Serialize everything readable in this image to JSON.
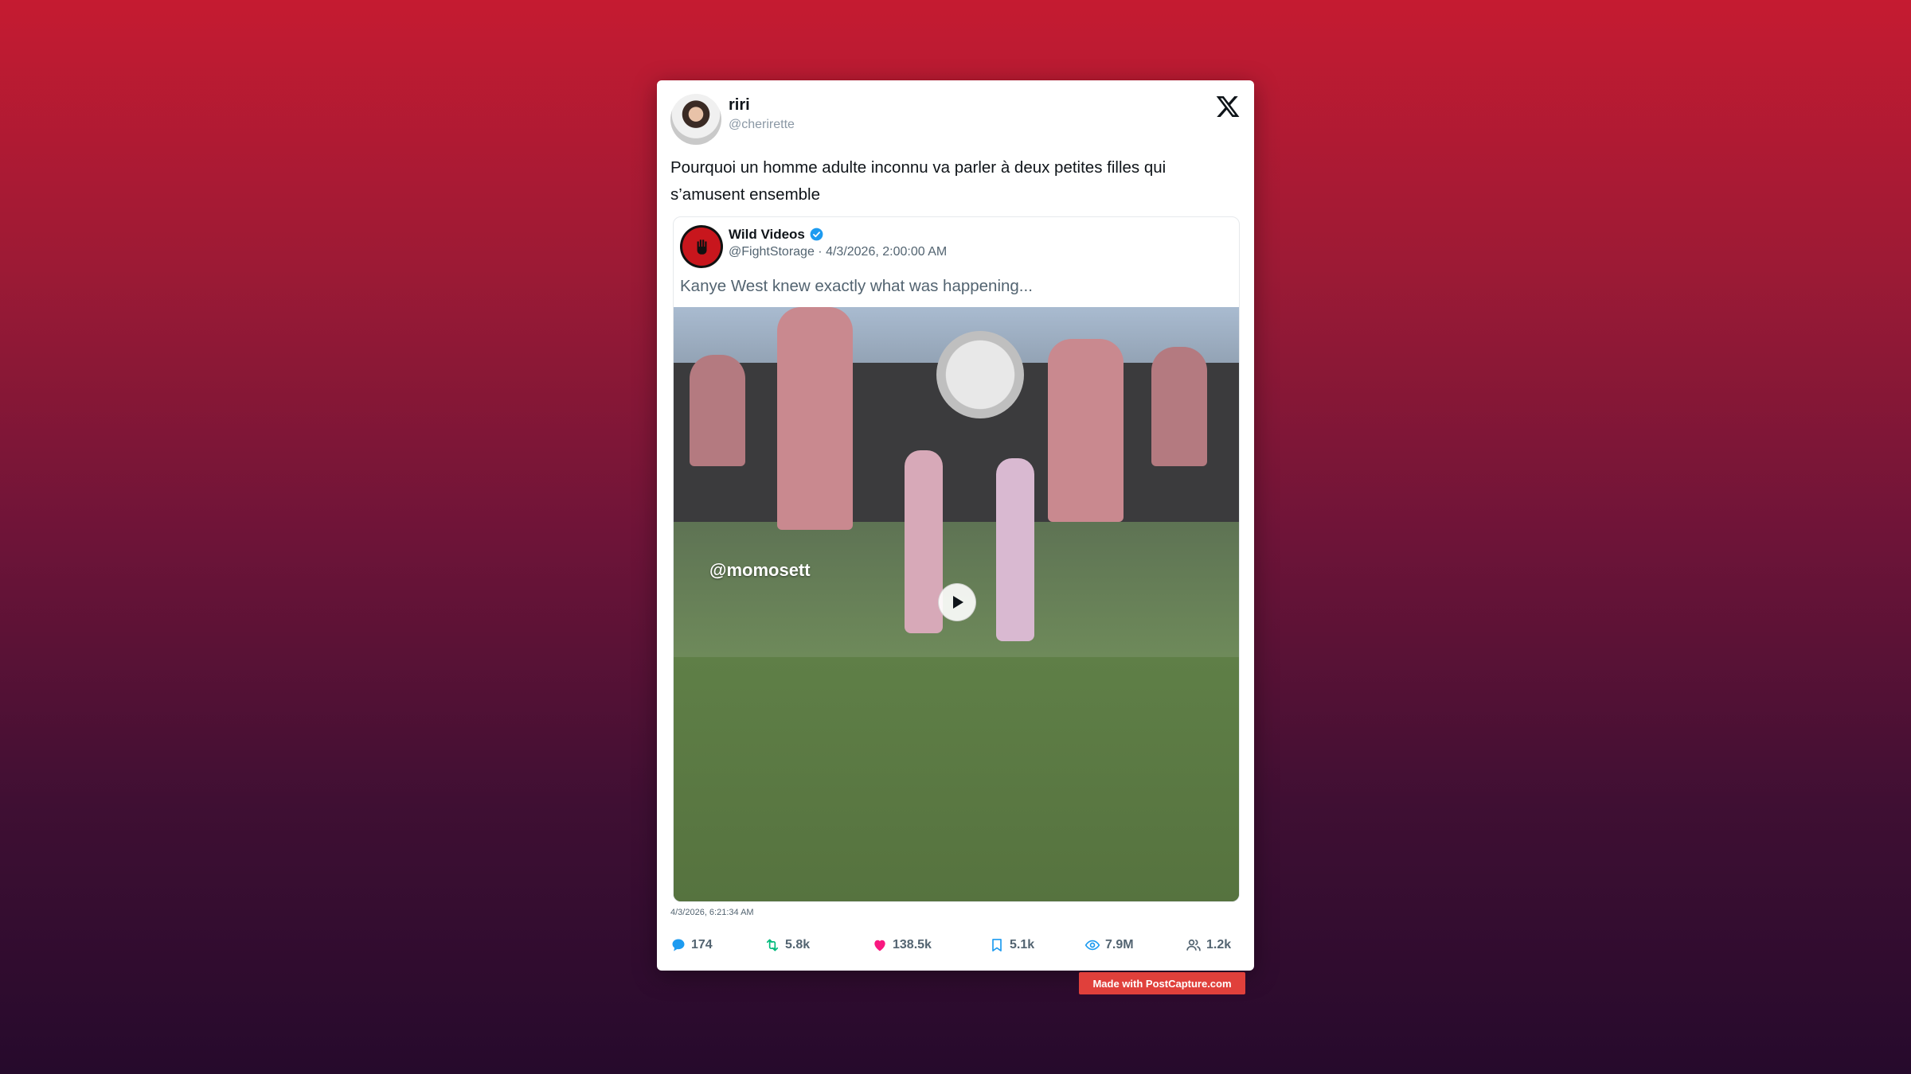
{
  "post": {
    "display_name": "riri",
    "handle": "@cherirette",
    "text": "Pourquoi un homme adulte inconnu va parler à deux petites filles qui s’amusent ensemble",
    "timestamp": "4/3/2026, 6:21:34 AM"
  },
  "quote": {
    "display_name": "Wild Videos",
    "handle_and_time": "@FightStorage · 4/3/2026, 2:00:00 AM",
    "text": "Kanye West knew exactly what was happening...",
    "video_watermark": "@momosett"
  },
  "stats": {
    "replies": "174",
    "reposts": "5.8k",
    "likes": "138.5k",
    "bookmarks": "5.1k",
    "views": "7.9M",
    "quotes": "1.2k"
  },
  "footer": {
    "badge": "Made with PostCapture.com"
  },
  "icons": {
    "brand": "x-logo-icon",
    "verified": "verified-badge-icon",
    "reply": "comment-icon",
    "repost": "repost-icon",
    "like": "heart-icon",
    "bookmark": "bookmark-icon",
    "views": "eye-icon",
    "quotes": "people-icon",
    "play": "play-icon"
  },
  "colors": {
    "reply": "#1d9bf0",
    "repost": "#00ba7c",
    "like": "#f91880",
    "bookmark": "#1d9bf0",
    "views": "#1d9bf0",
    "badge": "#e0403b"
  }
}
